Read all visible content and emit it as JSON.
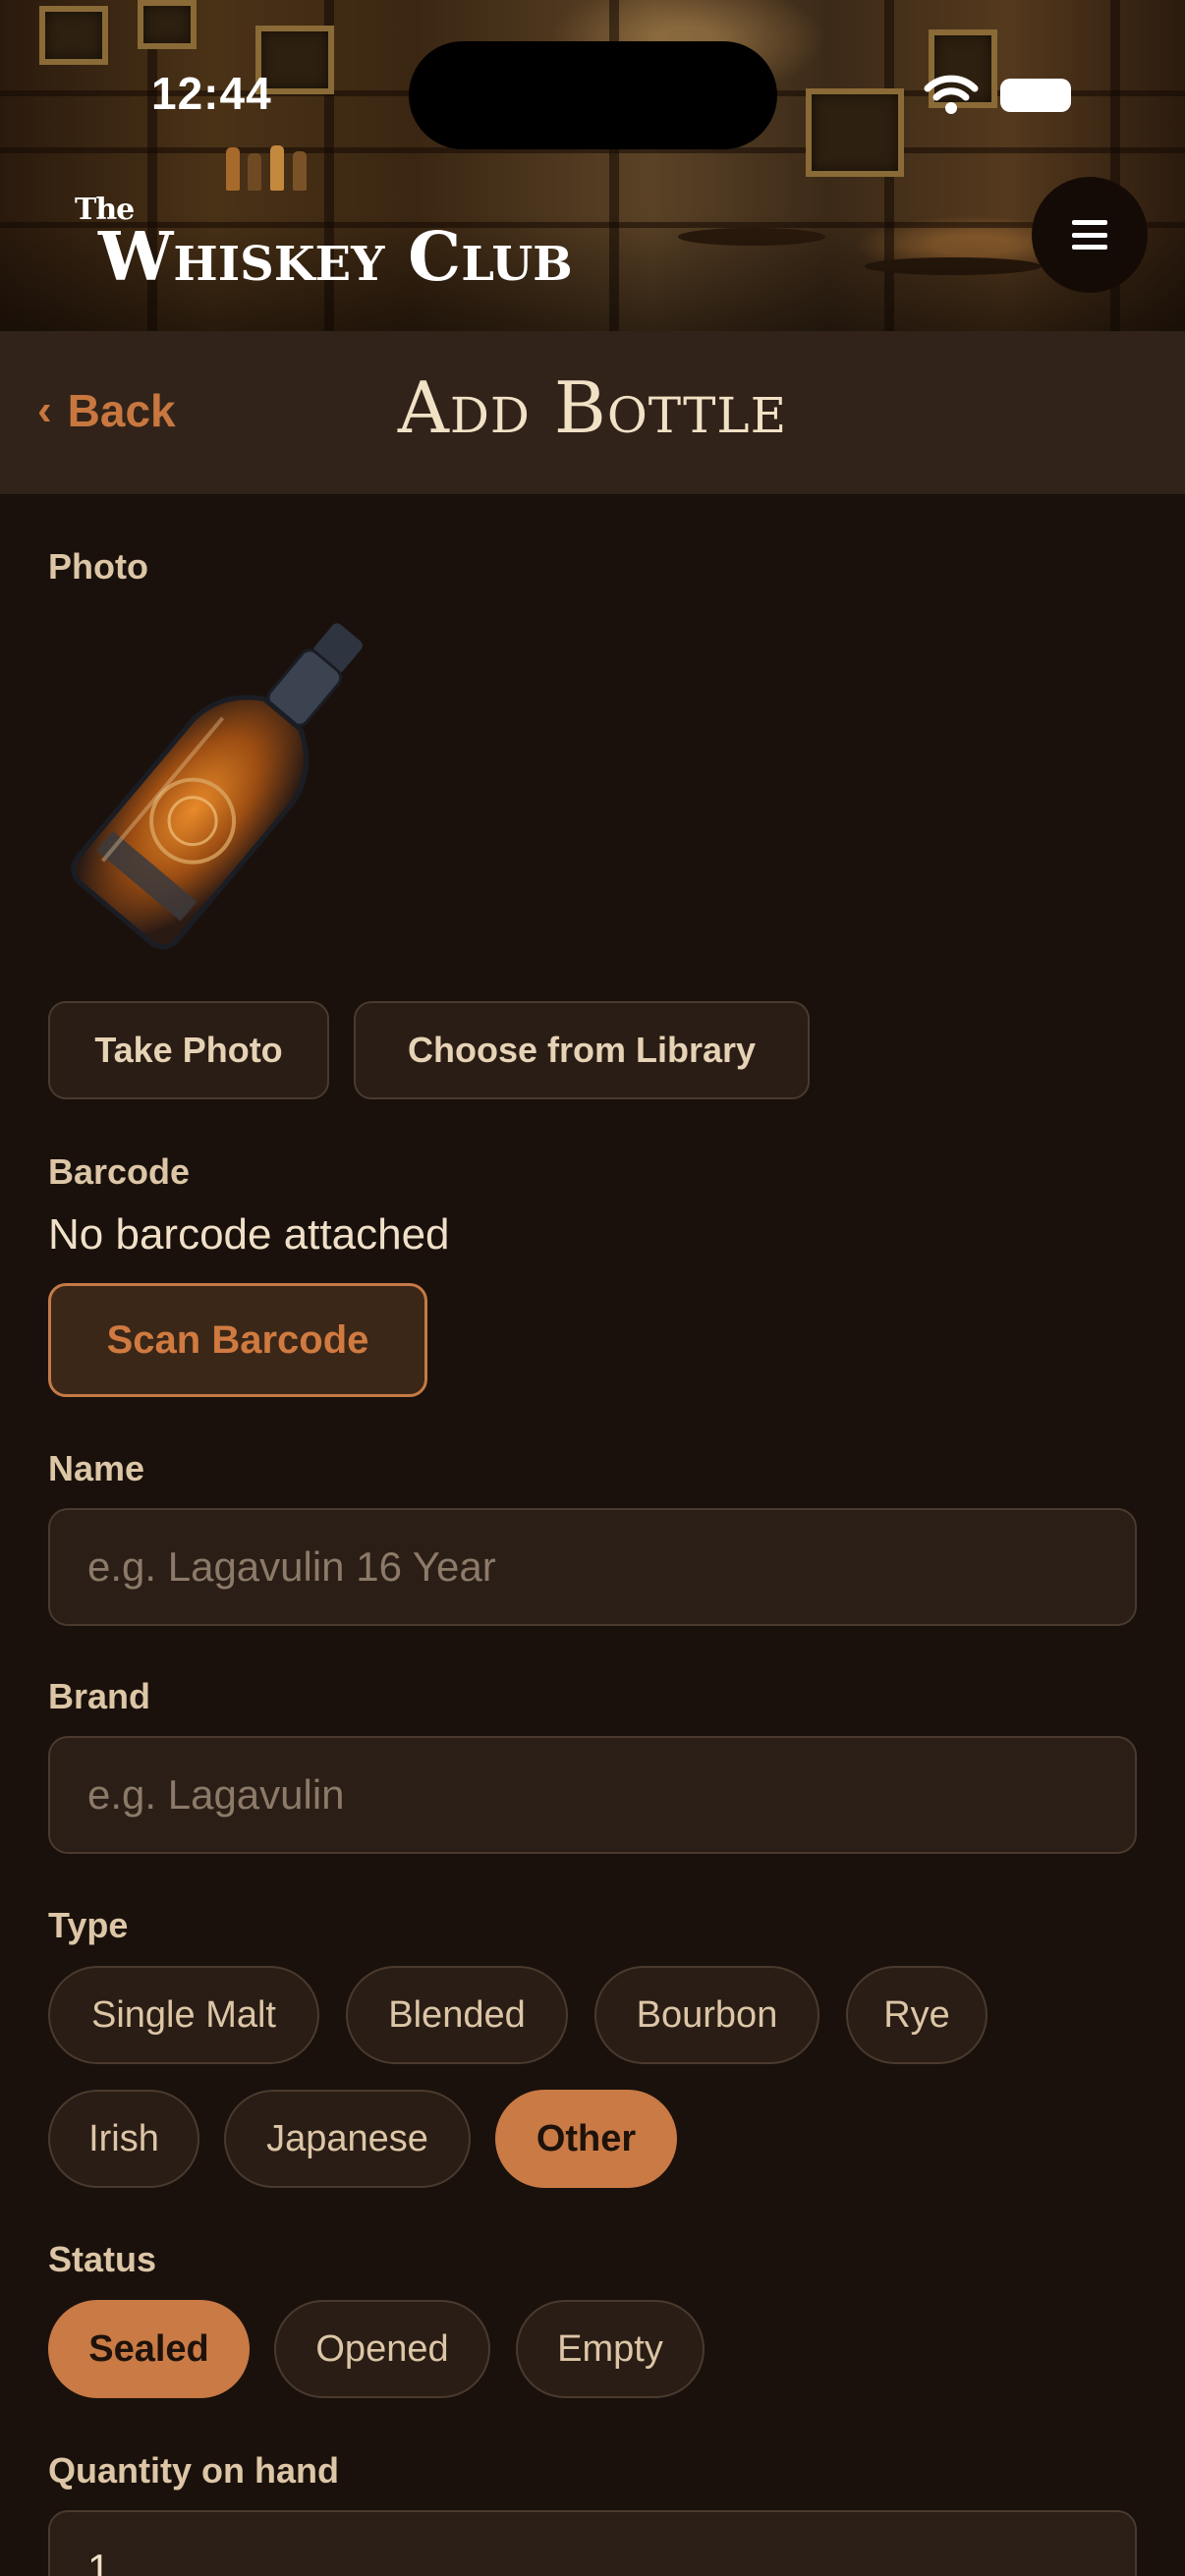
{
  "status_bar": {
    "time": "12:44"
  },
  "header": {
    "logo_the": "The",
    "logo_name": "Whiskey Club",
    "menu_icon": "hamburger-menu-icon"
  },
  "nav": {
    "back_label": "Back",
    "back_icon": "chevron-left-icon",
    "title": "Add Bottle"
  },
  "photo": {
    "label": "Photo",
    "take_photo": "Take Photo",
    "choose_library": "Choose from Library"
  },
  "barcode": {
    "label": "Barcode",
    "status": "No barcode attached",
    "scan_button": "Scan Barcode"
  },
  "name": {
    "label": "Name",
    "value": "",
    "placeholder": "e.g. Lagavulin 16 Year"
  },
  "brand": {
    "label": "Brand",
    "value": "",
    "placeholder": "e.g. Lagavulin"
  },
  "type": {
    "label": "Type",
    "options": [
      "Single Malt",
      "Blended",
      "Bourbon",
      "Rye",
      "Irish",
      "Japanese",
      "Other"
    ],
    "selected": "Other"
  },
  "status": {
    "label": "Status",
    "options": [
      "Sealed",
      "Opened",
      "Empty"
    ],
    "selected": "Sealed"
  },
  "quantity": {
    "label": "Quantity on hand",
    "value": "1"
  },
  "colors": {
    "accent": "#c97a45",
    "background": "#1a110c",
    "navbar": "#31231a"
  }
}
